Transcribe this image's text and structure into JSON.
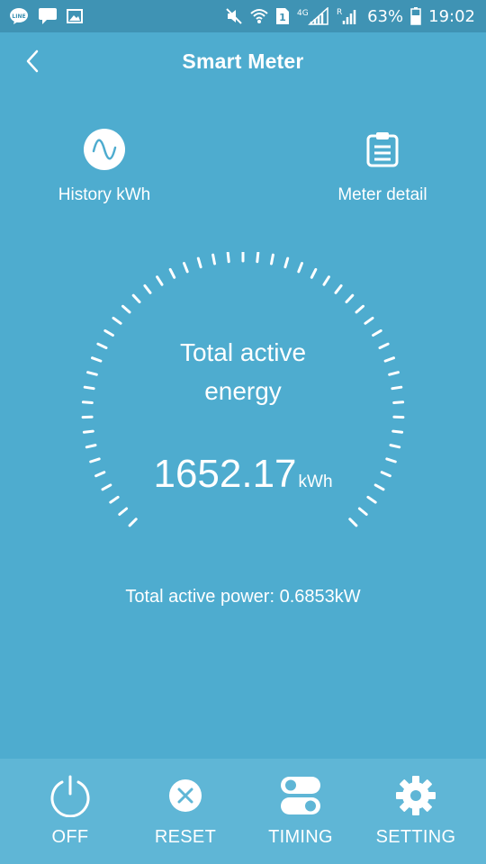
{
  "status_bar": {
    "left_icons": [
      "line-app-icon",
      "chat-bubble-icon",
      "image-icon"
    ],
    "right_icons": [
      "mute-icon",
      "wifi-icon",
      "sim1-icon",
      "signal-4g-icon",
      "signal-roaming-icon",
      "battery-icon"
    ],
    "network": "4G",
    "roaming": "R",
    "sim": "1",
    "battery": "63%",
    "time": "19:02"
  },
  "app_bar": {
    "title": "Smart Meter"
  },
  "shortcuts": {
    "history_label": "History kWh",
    "meter_label": "Meter detail"
  },
  "gauge": {
    "label_line1": "Total active",
    "label_line2": "energy",
    "value": "1652.17",
    "unit": "kWh"
  },
  "power": {
    "text": "Total active power: 0.6853kW"
  },
  "bottom_bar": {
    "off_label": "OFF",
    "reset_label": "RESET",
    "timing_label": "TIMING",
    "setting_label": "SETTING"
  },
  "colors": {
    "background": "#4eaccf",
    "status_bar": "#3f93b4",
    "bottom_bar": "#5fb6d6",
    "foreground": "#ffffff"
  }
}
